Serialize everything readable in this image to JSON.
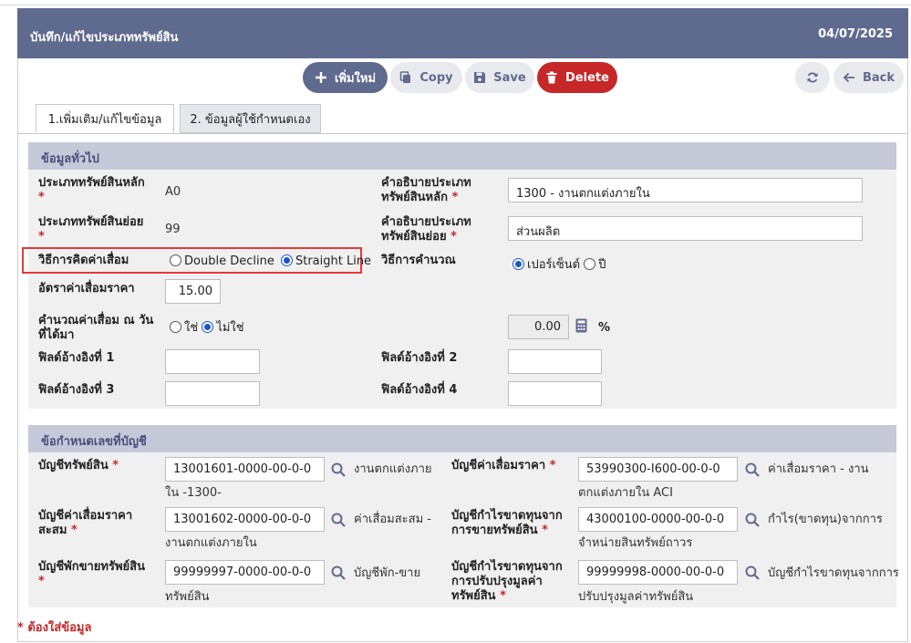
{
  "header": {
    "title": "บันทึก/แก้ไขประเภททรัพย์สิน",
    "date": "04/07/2025"
  },
  "toolbar": {
    "add_label": "เพิ่มใหม่",
    "copy_label": "Copy",
    "save_label": "Save",
    "delete_label": "Delete",
    "back_label": "Back"
  },
  "tabs": [
    {
      "label": "1.เพิ่มเติม/แก้ไขข้อมูล"
    },
    {
      "label": "2. ข้อมูลผู้ใช้กำหนดเอง"
    }
  ],
  "general": {
    "heading": "ข้อมูลทั่วไป",
    "main_type_label": "ประเภททรัพย์สินหลัก",
    "main_type_value": "A0",
    "main_desc_label_1": "คำอธิบายประเภท",
    "main_desc_label_2": "ทรัพย์สินหลัก",
    "main_desc_value": "1300 - งานตกแต่งภายใน",
    "sub_type_label": "ประเภททรัพย์สินย่อย",
    "sub_type_value": "99",
    "sub_desc_label_1": "คำอธิบายประเภท",
    "sub_desc_label_2": "ทรัพย์สินย่อย",
    "sub_desc_value": "ส่วนผลิต",
    "depr_method_label": "วิธีการคิดค่าเสื่อม",
    "depr_method_options": [
      "Double Decline",
      "Straight Line"
    ],
    "depr_method_selected": "Straight Line",
    "calc_method_label": "วิธีการคำนวณ",
    "calc_method_options": [
      "เปอร์เซ็นต์",
      "ปี"
    ],
    "calc_method_selected": "เปอร์เซ็นต์",
    "rate_label": "อัตราค่าเสื่อมราคา",
    "rate_value": "15.00",
    "calc_on_date_label_1": "คำนวณค่าเสื่อม ณ วัน",
    "calc_on_date_label_2": "ที่ได้มา",
    "calc_on_date_options": [
      "ใช่",
      "ไม่ใช่"
    ],
    "calc_on_date_selected": "ไม่ใช่",
    "percent_value": "0.00",
    "percent_unit": "%",
    "ref1_label": "ฟิลด์อ้างอิงที่ 1",
    "ref2_label": "ฟิลด์อ้างอิงที่ 2",
    "ref3_label": "ฟิลด์อ้างอิงที่ 3",
    "ref4_label": "ฟิลด์อ้างอิงที่ 4",
    "ref1_value": "",
    "ref2_value": "",
    "ref3_value": "",
    "ref4_value": ""
  },
  "accounts": {
    "heading": "ข้อกำหนดเลขที่บัญชี",
    "asset_label": "บัญชีทรัพย์สิน",
    "asset_value": "13001601-0000-00-0-0",
    "asset_desc_1": "งานตกแต่งภาย",
    "asset_desc_2": "ใน -1300-",
    "depr_label": "บัญชีค่าเสื่อมราคา",
    "depr_value": "53990300-I600-00-0-0",
    "depr_desc_1": "ค่าเสื่อมราคา - งาน",
    "depr_desc_2": "ตกแต่งภายใน ACI",
    "accum_label_1": "บัญชีค่าเสื่อมราคา",
    "accum_label_2": "สะสม",
    "accum_value": "13001602-0000-00-0-0",
    "accum_desc_1": "ค่าเสื่อมสะสม -",
    "accum_desc_2": "งานตกแต่งภายใน",
    "gainloss_label_1": "บัญชีกำไรขาดทุนจาก",
    "gainloss_label_2": "การขายทรัพย์สิน",
    "gainloss_value": "43000100-0000-00-0-0",
    "gainloss_desc_1": "กำไร(ขาดทุน)จากการ",
    "gainloss_desc_2": "จำหน่ายสินทรัพย์ถาวร",
    "suspense_label": "บัญชีพักขายทรัพย์สิน",
    "suspense_value": "99999997-0000-00-0-0",
    "suspense_desc_1": "บัญชีพัก-ขาย",
    "suspense_desc_2": "ทรัพย์สิน",
    "reval_label_1": "บัญชีกำไรขาดทุนจาก",
    "reval_label_2": "การปรับปรุงมูลค่า",
    "reval_label_3": "ทรัพย์สิน",
    "reval_value": "99999998-0000-00-0-0",
    "reval_desc_1": "บัญชีกำไรขาดทุนจากการ",
    "reval_desc_2": "ปรับปรุงมูลค่าทรัพย์สิน"
  },
  "footer": {
    "required_note": "* ต้องใส่ข้อมูล"
  },
  "colors": {
    "header_bg": "#5f6a8f",
    "delete_red": "#c62828",
    "section_head": "#c6c9d8",
    "highlight": "#e53935"
  }
}
